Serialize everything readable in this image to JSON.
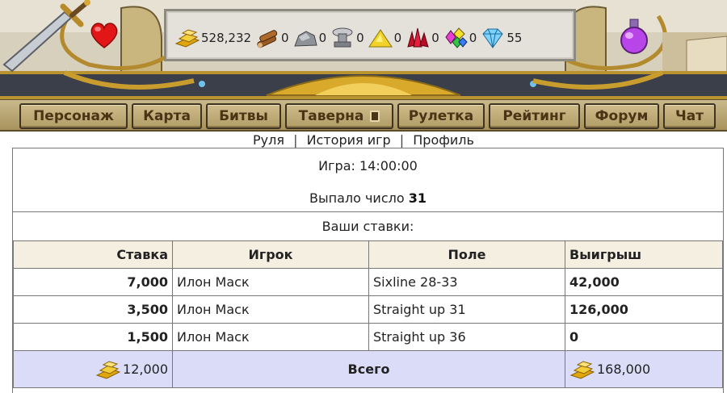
{
  "resources": [
    {
      "icon": "gold-bars-icon",
      "value": "528,232"
    },
    {
      "icon": "wood-logs-icon",
      "value": "0"
    },
    {
      "icon": "stone-icon",
      "value": "0"
    },
    {
      "icon": "iron-anvil-icon",
      "value": "0"
    },
    {
      "icon": "sulfur-pile-icon",
      "value": "0"
    },
    {
      "icon": "red-crystal-icon",
      "value": "0"
    },
    {
      "icon": "gems-icon",
      "value": "0"
    },
    {
      "icon": "diamond-icon",
      "value": "55"
    }
  ],
  "nav": {
    "character": "Персонаж",
    "map": "Карта",
    "battles": "Битвы",
    "tavern": "Таверна",
    "roulette": "Рулетка",
    "rating": "Рейтинг",
    "forum": "Форум",
    "chat": "Чат"
  },
  "sublinks": {
    "spin": "Руля",
    "history": "История игр",
    "profile": "Профиль",
    "sep": "|"
  },
  "game": {
    "title": "Игра: 14:00:00",
    "result_prefix": "Выпало число",
    "result_number": "31",
    "your_bets": "Ваши ставки:"
  },
  "table": {
    "headers": [
      "Ставка",
      "Игрок",
      "Поле",
      "Выигрыш"
    ],
    "rows": [
      {
        "bet": "7,000",
        "player": "Илон Маск",
        "field": "Sixline 28-33",
        "win": "42,000"
      },
      {
        "bet": "3,500",
        "player": "Илон Маск",
        "field": "Straight up 31",
        "win": "126,000"
      },
      {
        "bet": "1,500",
        "player": "Илон Маск",
        "field": "Straight up 36",
        "win": "0"
      }
    ],
    "total": {
      "bet": "12,000",
      "label": "Всего",
      "win": "168,000"
    }
  },
  "colors": {
    "nav_text": "#4b3415",
    "total_row_bg": "#dadcf8",
    "header_row_bg": "#f4efe1",
    "gold": "#f0c419"
  }
}
